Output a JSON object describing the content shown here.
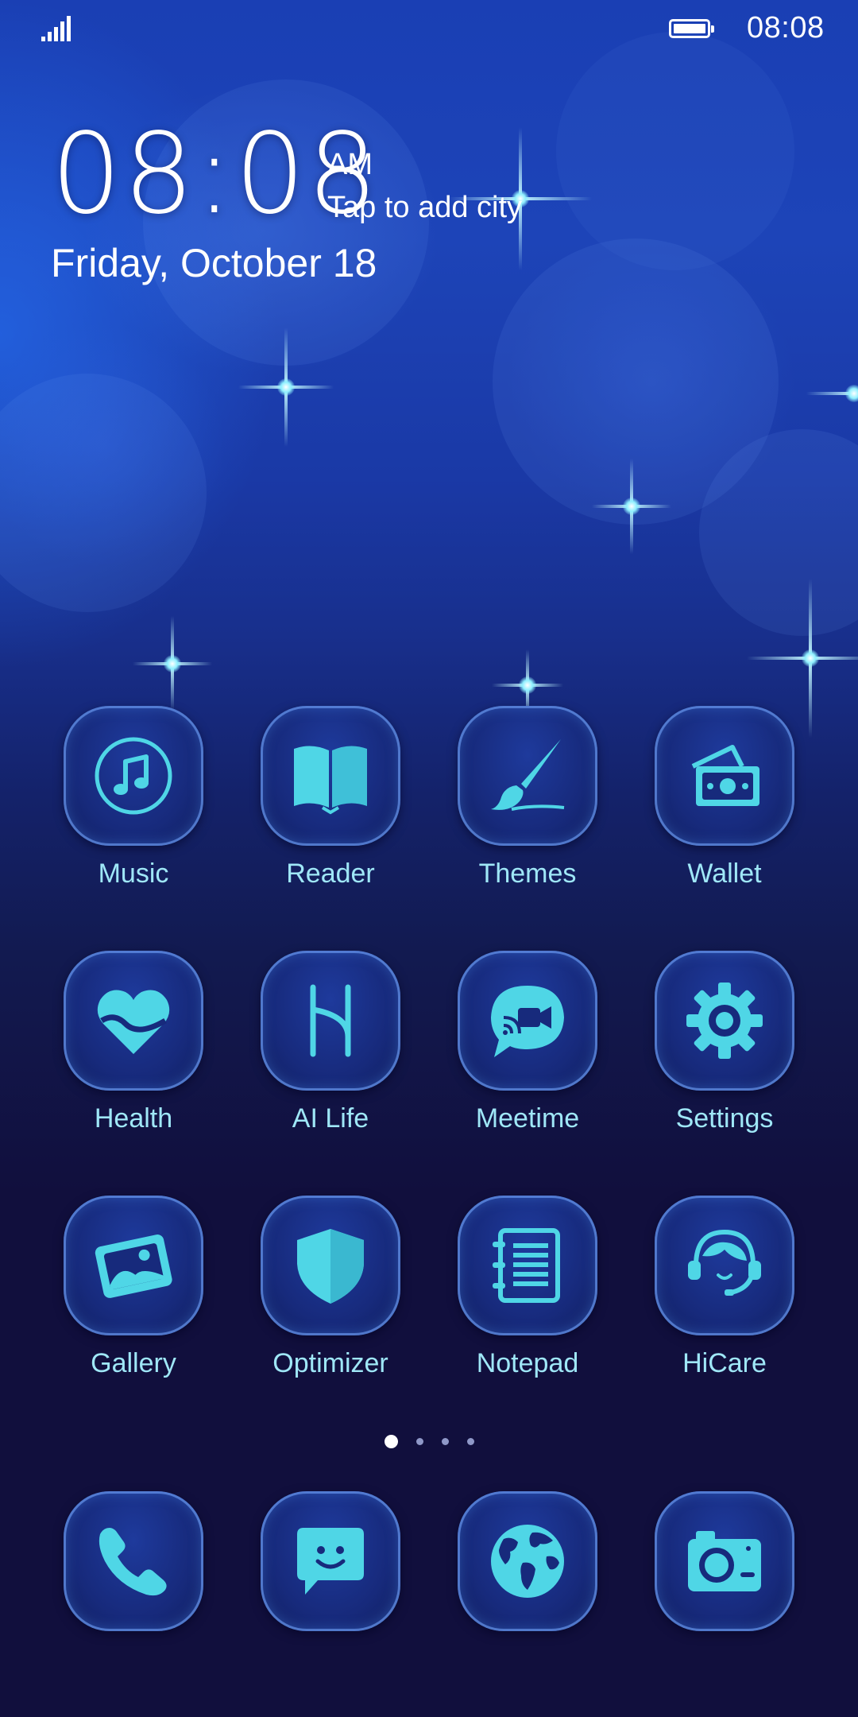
{
  "status_bar": {
    "time": "08:08",
    "signal_icon": "signal-bars-icon",
    "battery_icon": "battery-full-icon"
  },
  "clock_widget": {
    "time": "08:08",
    "ampm": "AM",
    "city_prompt": "Tap to add city",
    "date": "Friday, October 18"
  },
  "apps": [
    {
      "label": "Music",
      "icon": "music-note-icon"
    },
    {
      "label": "Reader",
      "icon": "open-book-icon"
    },
    {
      "label": "Themes",
      "icon": "paintbrush-icon"
    },
    {
      "label": "Wallet",
      "icon": "wallet-cash-icon"
    },
    {
      "label": "Health",
      "icon": "heart-icon"
    },
    {
      "label": "AI Life",
      "icon": "ai-life-icon"
    },
    {
      "label": "Meetime",
      "icon": "video-chat-bubble-icon"
    },
    {
      "label": "Settings",
      "icon": "gear-icon"
    },
    {
      "label": "Gallery",
      "icon": "photo-icon"
    },
    {
      "label": "Optimizer",
      "icon": "shield-icon"
    },
    {
      "label": "Notepad",
      "icon": "notepad-icon"
    },
    {
      "label": "HiCare",
      "icon": "headset-agent-icon"
    }
  ],
  "page_indicator": {
    "count": 4,
    "active_index": 0
  },
  "dock": [
    {
      "icon": "phone-icon"
    },
    {
      "icon": "message-bubble-icon"
    },
    {
      "icon": "globe-icon"
    },
    {
      "icon": "camera-icon"
    }
  ],
  "colors": {
    "icon_glyph": "#4fd6e6",
    "label_text": "#9fe7f7",
    "background_top": "#1a3fb4",
    "background_bottom": "#110f3d"
  }
}
